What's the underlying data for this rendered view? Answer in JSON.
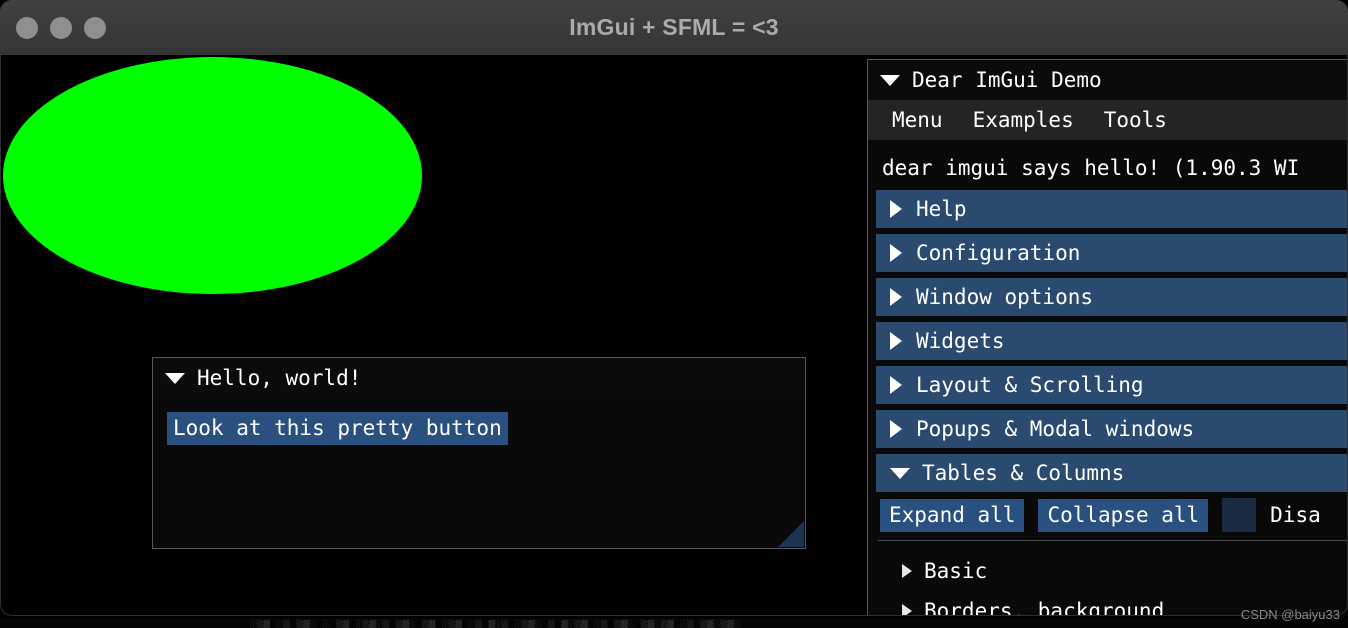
{
  "os_window": {
    "title": "ImGui + SFML = <3",
    "traffic_lights": [
      "close",
      "minimize",
      "zoom"
    ]
  },
  "canvas": {
    "background_color": "#000000",
    "shape": {
      "type": "ellipse",
      "color": "#00ff00",
      "name": "green-ellipse"
    }
  },
  "hello_window": {
    "title": "Hello, world!",
    "collapse_state": "expanded",
    "button_label": "Look at this pretty button"
  },
  "demo_window": {
    "title": "Dear ImGui Demo",
    "collapse_state": "expanded",
    "menu": [
      {
        "label": "Menu"
      },
      {
        "label": "Examples"
      },
      {
        "label": "Tools"
      }
    ],
    "greeting": "dear imgui says hello! (1.90.3 WI",
    "tree_headers": [
      {
        "label": "Help",
        "state": "collapsed"
      },
      {
        "label": "Configuration",
        "state": "collapsed"
      },
      {
        "label": "Window options",
        "state": "collapsed"
      },
      {
        "label": "Widgets",
        "state": "collapsed"
      },
      {
        "label": "Layout & Scrolling",
        "state": "collapsed"
      },
      {
        "label": "Popups & Modal windows",
        "state": "collapsed"
      },
      {
        "label": "Tables & Columns",
        "state": "expanded"
      }
    ],
    "table_controls": {
      "expand_all_label": "Expand all",
      "collapse_all_label": "Collapse all",
      "checkbox_checked": false,
      "checkbox_label": "Disa"
    },
    "sub_items": [
      {
        "label": "Basic",
        "state": "collapsed"
      },
      {
        "label": "Borders, background",
        "state": "collapsed"
      }
    ]
  },
  "watermark": {
    "text": "CSDN @baiyu33"
  },
  "colors": {
    "accent_blue": "#2a5080",
    "header_blue": "#2a4a70",
    "green": "#00ff00",
    "titlebar_gray": "#3b3b3b"
  },
  "bottom_peek": {
    "text": "░▒▓ ░▒ ▒▓░ ░ ▒▓ ░▒▓░▒ ▒▓░ ▒▓ ░▒▓ ░▒ ▓░▒ ░▒▓░ ▒ ▓░▒▓ ░▒ ▒▓░ ▒▓░▒▓ ░▒ ▒▓░▒▓░"
  }
}
